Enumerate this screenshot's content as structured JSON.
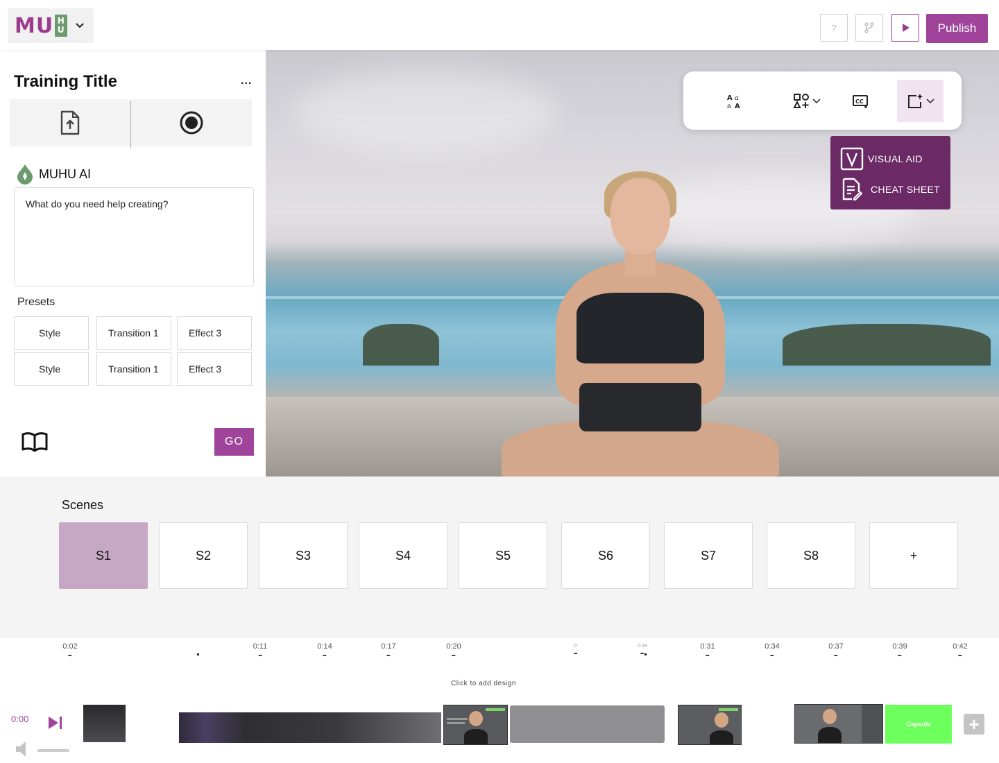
{
  "brand": {
    "logo_text": "MU",
    "logo_h": "H",
    "logo_u": "U",
    "accent_color": "#a0439a",
    "logo_green": "#6b9a6e"
  },
  "toolbar": {
    "help_label": "?",
    "publish_label": "Publish",
    "icons": [
      "help-icon",
      "branch-icon",
      "play-icon"
    ]
  },
  "left_panel": {
    "training_title": "Training Title",
    "more_label": "...",
    "media_icons": [
      "upload-file-icon",
      "record-icon"
    ],
    "ai": {
      "label": "MUHU AI",
      "prompt_placeholder": "What do you need help creating?"
    },
    "presets_label": "Presets",
    "presets": [
      [
        "Style",
        "Transition 1",
        "Effect 3"
      ],
      [
        "Style",
        "Transition 1",
        "Effect 3"
      ]
    ],
    "go_label": "GO"
  },
  "video": {
    "tools": [
      "text-translate-icon",
      "shapes-icon",
      "captions-icon",
      "add-visual-icon"
    ],
    "dropdown": [
      {
        "label": "VISUAL AID",
        "icon": "visual-aid-icon"
      },
      {
        "label": "CHEAT SHEET",
        "icon": "cheat-sheet-icon"
      }
    ],
    "dropdown_color": "#6b2a66"
  },
  "scenes": {
    "label": "Scenes",
    "items": [
      "S1",
      "S2",
      "S3",
      "S4",
      "S5",
      "S6",
      "S7",
      "S8"
    ],
    "add_label": "+",
    "active": "S1",
    "active_color": "#c7a8c4"
  },
  "timeline": {
    "ticks": [
      "0:02",
      "0:11",
      "0:14",
      "0:17",
      "0:20",
      "0:",
      "0:28",
      "0:31",
      "0:34",
      "0:37",
      "0:39",
      "0:42"
    ],
    "add_design_label": "Click to add design",
    "current_time": "0:00",
    "capsule_label": "Capsule",
    "add_clip_label": "+",
    "capsule_color": "#6dff5c"
  }
}
